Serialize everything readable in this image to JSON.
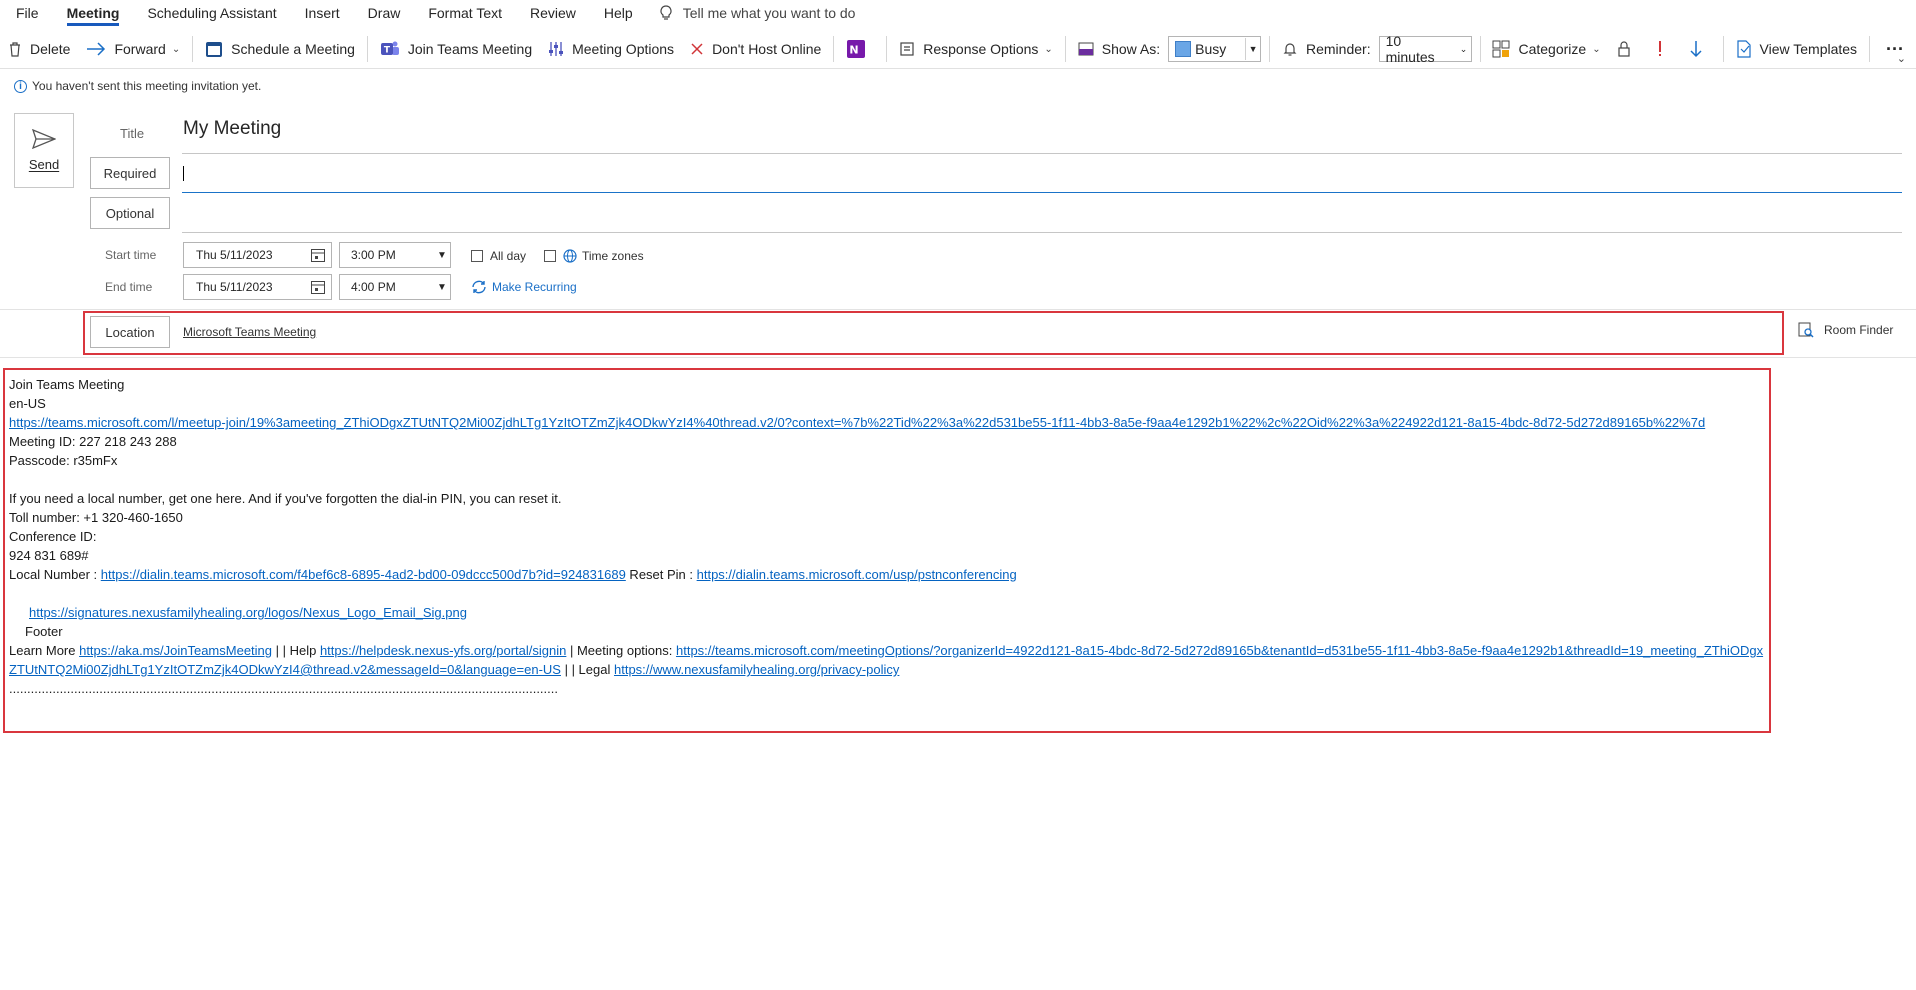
{
  "menu": {
    "tabs": [
      {
        "label": "File"
      },
      {
        "label": "Meeting",
        "active": true
      },
      {
        "label": "Scheduling Assistant"
      },
      {
        "label": "Insert"
      },
      {
        "label": "Draw"
      },
      {
        "label": "Format Text"
      },
      {
        "label": "Review"
      },
      {
        "label": "Help"
      }
    ],
    "tell_me": "Tell me what you want to do"
  },
  "ribbon": {
    "delete": "Delete",
    "forward": "Forward",
    "schedule_meeting": "Schedule a Meeting",
    "join_teams": "Join Teams Meeting",
    "meeting_options": "Meeting Options",
    "dont_host_online": "Don't Host Online",
    "response_options": "Response Options",
    "show_as_label": "Show As:",
    "show_as_value": "Busy",
    "reminder_label": "Reminder:",
    "reminder_value": "10 minutes",
    "categorize": "Categorize",
    "view_templates": "View Templates",
    "more": "···"
  },
  "infobar": {
    "message": "You haven't sent this meeting invitation yet."
  },
  "send": {
    "label": "Send"
  },
  "form": {
    "title_label": "Title",
    "title_value": "My Meeting",
    "required_label": "Required",
    "optional_label": "Optional",
    "start_label": "Start time",
    "end_label": "End time",
    "start_date": "Thu 5/11/2023",
    "start_time": "3:00 PM",
    "end_date": "Thu 5/11/2023",
    "end_time": "4:00 PM",
    "all_day": "All day",
    "time_zones": "Time zones",
    "make_recurring": "Make Recurring",
    "location_label": "Location",
    "location_value": "Microsoft Teams Meeting",
    "room_finder": "Room Finder"
  },
  "body": {
    "join": "Join Teams Meeting",
    "locale": "en-US",
    "join_url": "https://teams.microsoft.com/l/meetup-join/19%3ameeting_ZThiODgxZTUtNTQ2Mi00ZjdhLTg1YzItOTZmZjk4ODkwYzI4%40thread.v2/0?context=%7b%22Tid%22%3a%22d531be55-1f11-4bb3-8a5e-f9aa4e1292b1%22%2c%22Oid%22%3a%224922d121-8a15-4bdc-8d72-5d272d89165b%22%7d",
    "meeting_id": "Meeting ID: 227 218 243 288",
    "passcode": "Passcode: r35mFx",
    "local_number_note": "If you need a local number, get one here. And if you've forgotten the dial-in PIN, you can reset it.",
    "toll_number": "Toll number: +1 320-460-1650",
    "conference_id_label": "Conference ID:",
    "conference_id": "924 831 689#",
    "local_number_label": "Local Number : ",
    "local_number_url": "https://dialin.teams.microsoft.com/f4bef6c8-6895-4ad2-bd00-09dccc500d7b?id=924831689",
    "reset_pin_label": " Reset Pin : ",
    "reset_pin_url": "https://dialin.teams.microsoft.com/usp/pstnconferencing",
    "signature_url": "https://signatures.nexusfamilyhealing.org/logos/Nexus_Logo_Email_Sig.png",
    "footer": "Footer",
    "learn_more_label": "Learn More ",
    "learn_more_url": "https://aka.ms/JoinTeamsMeeting",
    "help_label": " | | Help ",
    "help_url": "https://helpdesk.nexus-yfs.org/portal/signin",
    "options_label": " | Meeting options: ",
    "options_url": "https://teams.microsoft.com/meetingOptions/?organizerId=4922d121-8a15-4bdc-8d72-5d272d89165b&tenantId=d531be55-1f11-4bb3-8a5e-f9aa4e1292b1&threadId=19_meeting_ZThiODgxZTUtNTQ2Mi00ZjdhLTg1YzItOTZmZjk4ODkwYzI4@thread.v2&messageId=0&language=en-US",
    "legal_label": " | | Legal ",
    "legal_url": "https://www.nexusfamilyhealing.org/privacy-policy",
    "dots": "........................................................................................................................................................"
  }
}
